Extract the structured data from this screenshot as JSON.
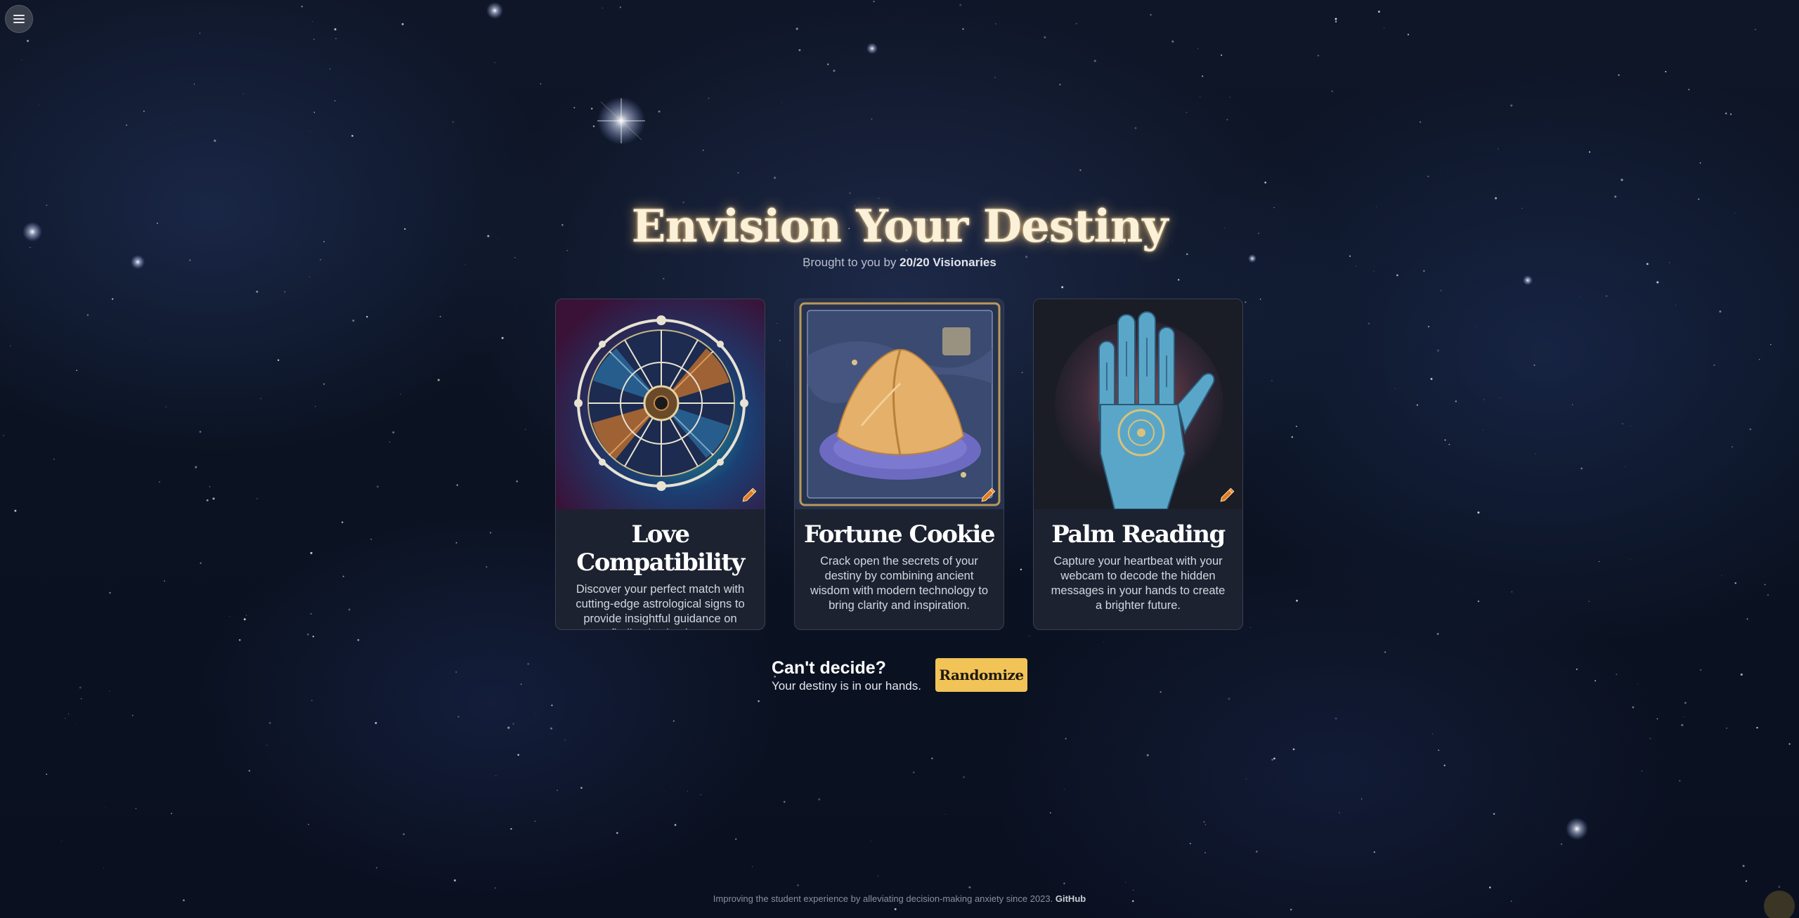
{
  "menu": {
    "icon": "hamburger-icon"
  },
  "header": {
    "title": "Envision Your Destiny",
    "subtitle_prefix": "Brought to you by",
    "team": "20/20 Visionaries"
  },
  "cards": [
    {
      "title": "Love Compatibility",
      "description": "Discover your perfect match with cutting-edge astrological signs to provide insightful guidance on finding lasting love.",
      "image": "zodiac-wheel-image",
      "badge_icon": "pencil-icon"
    },
    {
      "title": "Fortune Cookie",
      "description": "Crack open the secrets of your destiny by combining ancient wisdom with modern technology to bring clarity and inspiration.",
      "image": "fortune-cookie-image",
      "badge_icon": "pencil-icon"
    },
    {
      "title": "Palm Reading",
      "description": "Capture your heartbeat with your webcam to decode the hidden messages in your hands to create a brighter future.",
      "image": "palm-hand-image",
      "badge_icon": "pencil-icon"
    }
  ],
  "cta": {
    "heading": "Can't decide?",
    "subtext": "Your destiny is in our hands.",
    "button_label": "Randomize"
  },
  "footer": {
    "text": "Improving the student experience by alleviating decision-making anxiety since 2023.",
    "link_label": "GitHub"
  },
  "colors": {
    "accent": "#f2c457",
    "title_glow": "#ffcd78",
    "card_bg": "#1d2230",
    "background": "#0b1322"
  }
}
